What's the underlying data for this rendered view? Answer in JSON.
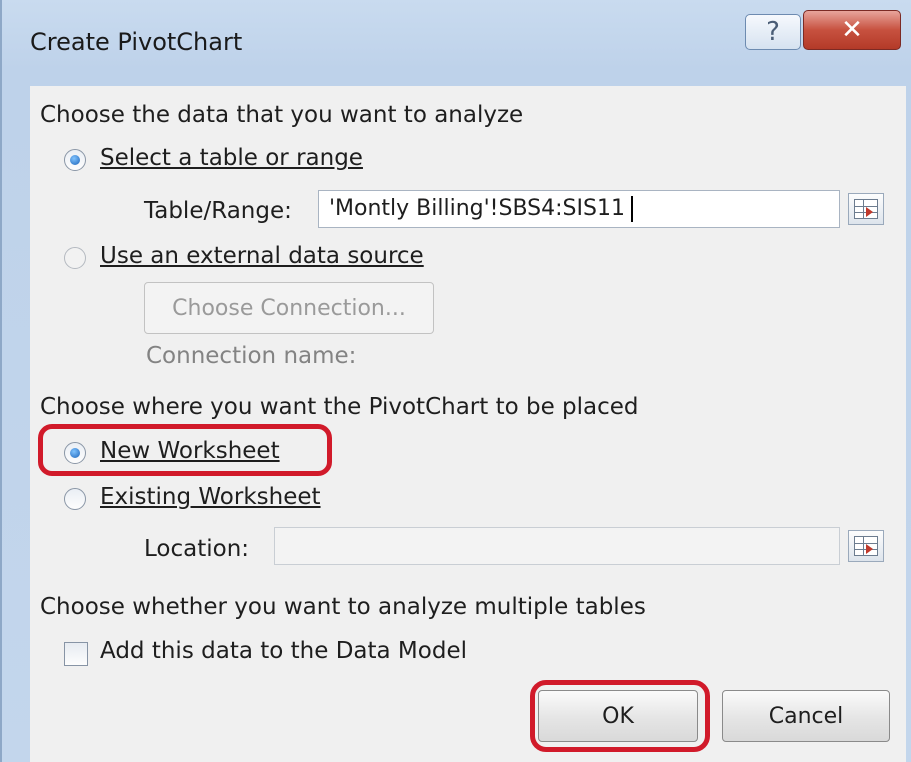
{
  "dialog": {
    "title": "Create PivotChart",
    "help_icon": "question-mark-icon",
    "close_icon": "close-x-icon",
    "help_glyph": "?",
    "close_glyph": "✕"
  },
  "data_section": {
    "heading": "Choose the data that you want to analyze",
    "select_table_label": "Select a table or range",
    "table_range_label": "Table/Range:",
    "table_range_value": "'Montly Billing'!SBS4:SIS11",
    "external_label": "Use an external data source",
    "choose_connection_label": "Choose Connection...",
    "connection_name_label": "Connection name:"
  },
  "placement_section": {
    "heading": "Choose where you want the PivotChart to be placed",
    "new_worksheet_label": "New Worksheet",
    "existing_worksheet_label": "Existing Worksheet",
    "location_label": "Location:",
    "location_value": ""
  },
  "tables_section": {
    "heading": "Choose whether you want to analyze multiple tables",
    "data_model_label": "Add this data to the Data Model"
  },
  "buttons": {
    "ok_label": "OK",
    "cancel_label": "Cancel"
  },
  "colors": {
    "highlight": "#d11a2a",
    "close_button": "#c7513f",
    "title_bar": "#c9dbef"
  }
}
